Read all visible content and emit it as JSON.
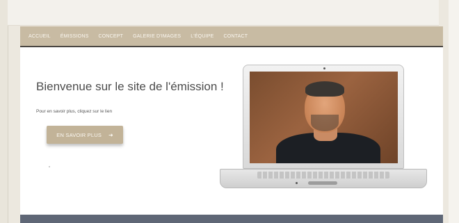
{
  "nav": {
    "items": [
      {
        "label": "ACCUEIL"
      },
      {
        "label": "ÉMISSIONS"
      },
      {
        "label": "CONCEPT"
      },
      {
        "label": "GALERIE D'IMAGES"
      },
      {
        "label": "L'ÉQUIPE"
      },
      {
        "label": "CONTACT"
      }
    ]
  },
  "hero": {
    "title": "Bienvenue sur le site de l'émission !",
    "subtitle": "Pour en savoir plus, cliquez sur le lien",
    "cta_label": "EN SAVOIR PLUS",
    "cta_icon": "arrow-right-icon"
  },
  "colors": {
    "nav_bg": "#c8bba3",
    "button_bg": "#c2b398",
    "footer_bg": "#5f6776",
    "page_bg": "#ece8df"
  }
}
